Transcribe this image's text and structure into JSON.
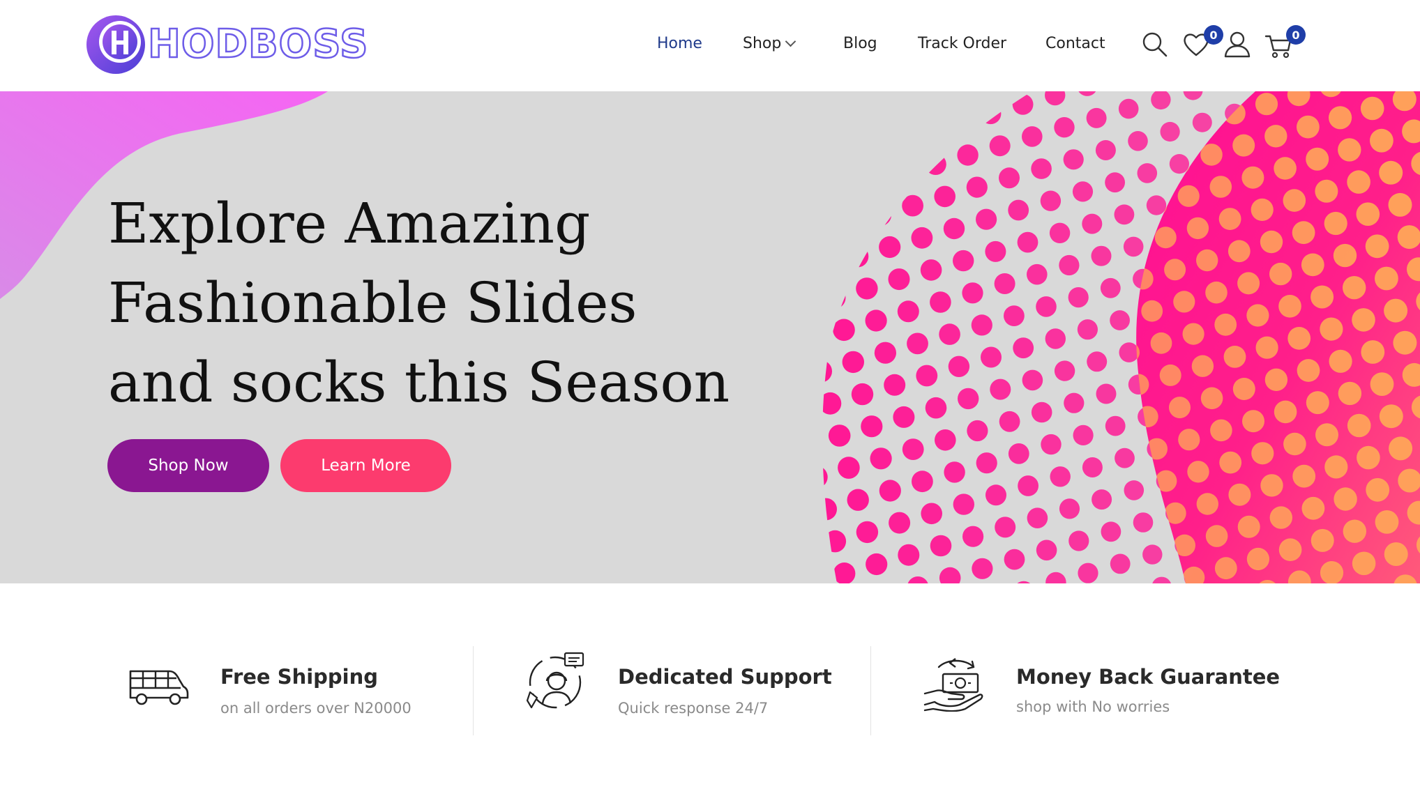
{
  "brand": {
    "logo_text": "HODBOSS",
    "logo_letter": "H",
    "colors": {
      "logo_outline": "#6d5ce8",
      "logo_gradient_start": "#9b4fe8",
      "logo_gradient_end": "#4a4fd8"
    }
  },
  "nav": {
    "items": [
      {
        "label": "Home",
        "active": true
      },
      {
        "label": "Shop",
        "has_dropdown": true
      },
      {
        "label": "Blog"
      },
      {
        "label": "Track Order"
      },
      {
        "label": "Contact"
      }
    ],
    "active_color": "#1f3a8a"
  },
  "header_icons": {
    "search": "search-icon",
    "wishlist": {
      "icon": "heart-icon",
      "count": "0"
    },
    "account": "user-icon",
    "cart": {
      "icon": "cart-icon",
      "count": "0"
    },
    "badge_color": "#1f3ea8"
  },
  "hero": {
    "title_lines": [
      "Explore Amazing",
      "Fashionable Slides",
      "and socks this Season"
    ],
    "primary_button": "Shop Now",
    "secondary_button": "Learn More",
    "colors": {
      "background": "#d9d9d9",
      "primary_button": "#8a1791",
      "secondary_button": "#fc3b6e",
      "blob_left": "#f06bf0",
      "dots_pink": "#ff1493",
      "dots_orange": "#ffa05a"
    }
  },
  "features": [
    {
      "icon": "van-icon",
      "title": "Free Shipping",
      "subtitle": "on all orders over N20000"
    },
    {
      "icon": "support-agent-icon",
      "title": "Dedicated Support",
      "subtitle": "Quick response 24/7"
    },
    {
      "icon": "money-back-icon",
      "title": "Money Back Guarantee",
      "subtitle": "shop with No worries"
    }
  ]
}
